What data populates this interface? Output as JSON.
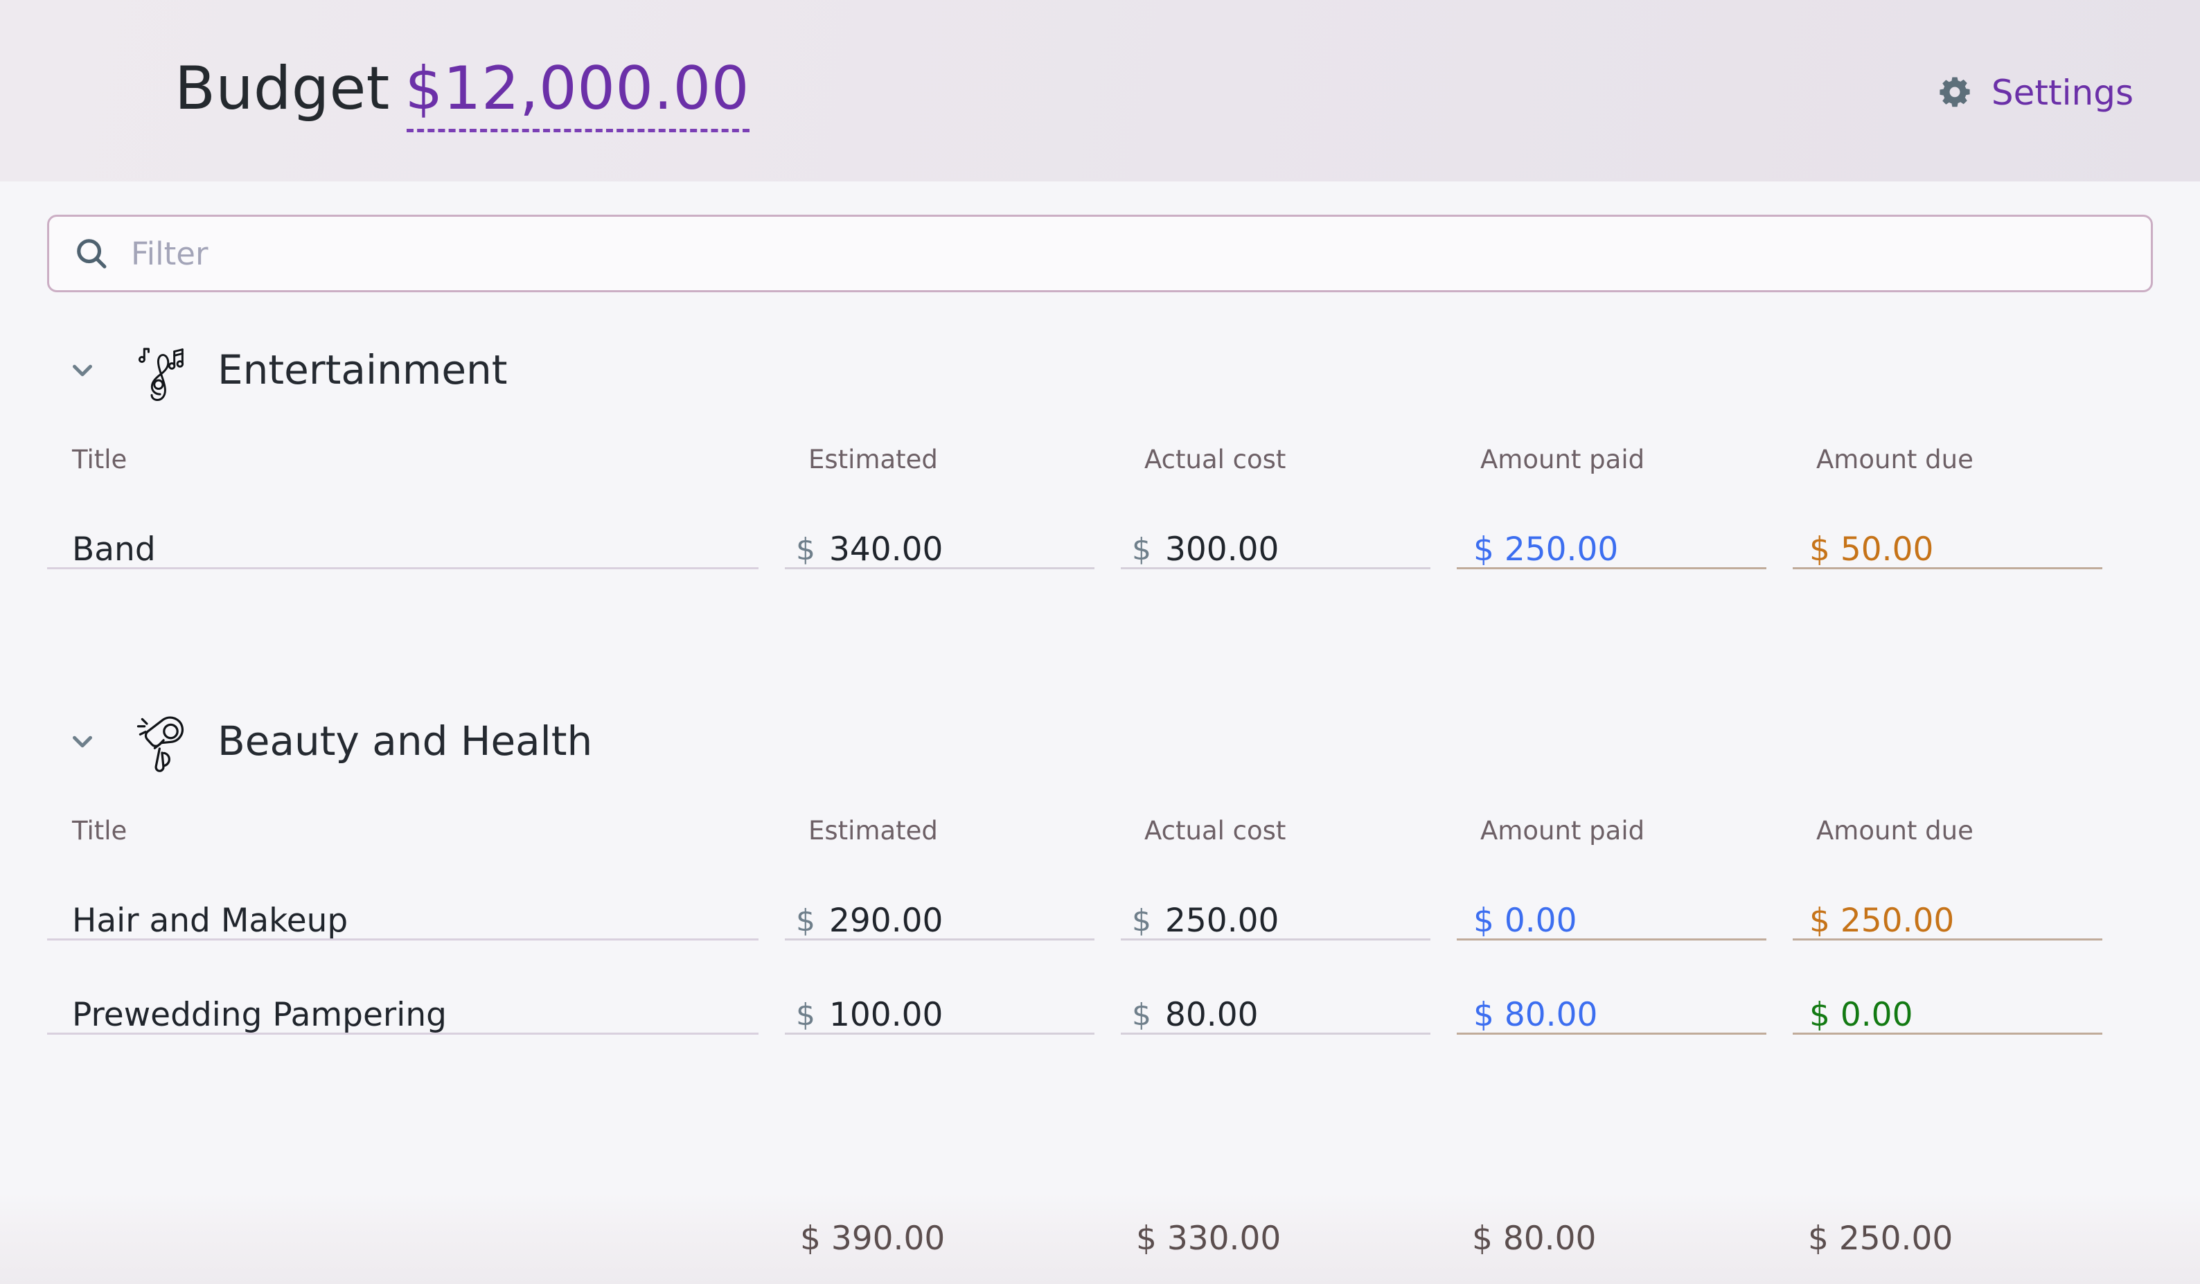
{
  "header": {
    "title_label": "Budget",
    "budget_amount": "$12,000.00",
    "settings_label": "Settings",
    "gear_icon": "gear-icon",
    "accent_purple": "#6b30a8",
    "header_bg": "#eae5ec"
  },
  "search": {
    "placeholder": "Filter",
    "value": "",
    "icon": "search-icon"
  },
  "columns": {
    "title": "Title",
    "estimated": "Estimated",
    "actual_cost": "Actual cost",
    "amount_paid": "Amount paid",
    "amount_due": "Amount due"
  },
  "currency_symbol": "$",
  "categories": [
    {
      "name": "Entertainment",
      "icon": "music-note-icon",
      "expanded": true,
      "chevron": "chevron-down-icon",
      "items": [
        {
          "title": "Band",
          "estimated": "340.00",
          "actual_cost": "300.00",
          "amount_paid": "$ 250.00",
          "amount_due": "$ 50.00",
          "due_state": "due"
        }
      ]
    },
    {
      "name": "Beauty and Health",
      "icon": "hair-dryer-icon",
      "expanded": true,
      "chevron": "chevron-down-icon",
      "items": [
        {
          "title": "Hair and Makeup",
          "estimated": "290.00",
          "actual_cost": "250.00",
          "amount_paid": "$ 0.00",
          "amount_due": "$ 250.00",
          "due_state": "due"
        },
        {
          "title": "Prewedding Pampering",
          "estimated": "100.00",
          "actual_cost": "80.00",
          "amount_paid": "$ 80.00",
          "amount_due": "$ 0.00",
          "due_state": "clear"
        }
      ]
    }
  ],
  "totals": {
    "estimated": "$ 390.00",
    "actual_cost": "$ 330.00",
    "amount_paid": "$ 80.00",
    "amount_due": "$ 250.00"
  },
  "colors": {
    "paid_blue": "#3c6ef0",
    "due_orange": "#c67318",
    "clear_green": "#137a13",
    "accent_purple": "#6b30a8",
    "field_underline": "#d5cfda",
    "accent_underline": "#c0ab9a"
  }
}
